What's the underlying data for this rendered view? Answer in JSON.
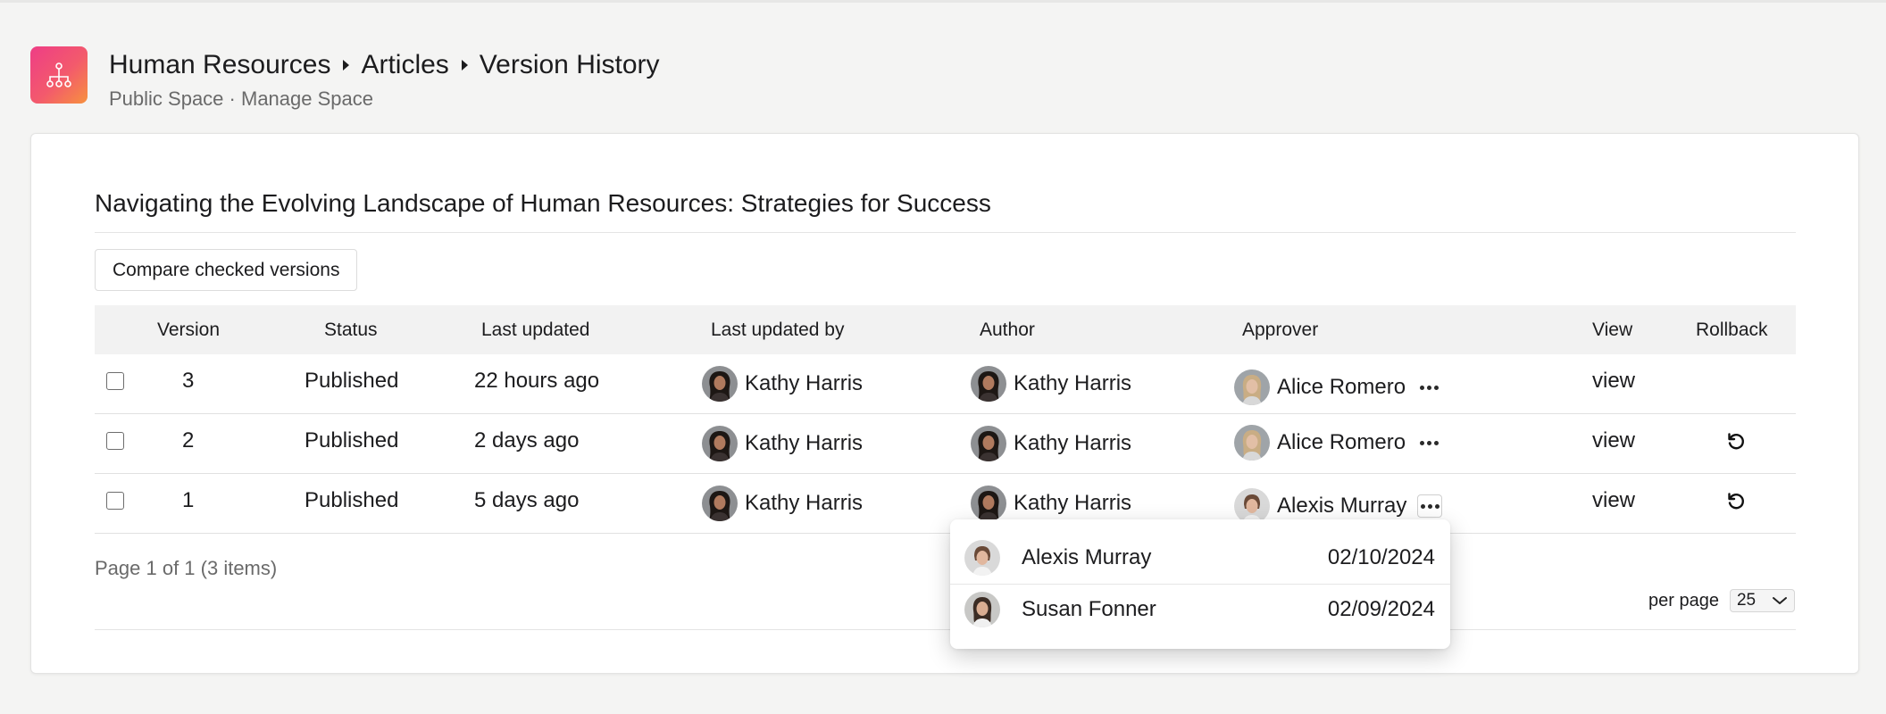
{
  "header": {
    "logo_icon": "org-chart-icon",
    "breadcrumbs": [
      "Human Resources",
      "Articles",
      "Version History"
    ],
    "subtitle_space": "Public Space",
    "subtitle_separator": "·",
    "subtitle_manage": "Manage Space"
  },
  "article": {
    "title": "Navigating the Evolving Landscape of Human Resources: Strategies for Success",
    "compare_button": "Compare checked versions"
  },
  "table": {
    "columns": {
      "version": "Version",
      "status": "Status",
      "last_updated": "Last updated",
      "last_updated_by": "Last updated by",
      "author": "Author",
      "approver": "Approver",
      "view": "View",
      "rollback": "Rollback"
    },
    "rows": [
      {
        "version": "3",
        "status": "Published",
        "last_updated": "22 hours ago",
        "last_updated_by": "Kathy Harris",
        "author": "Kathy Harris",
        "approver": "Alice Romero",
        "view": "view",
        "rollback": false
      },
      {
        "version": "2",
        "status": "Published",
        "last_updated": "2 days ago",
        "last_updated_by": "Kathy Harris",
        "author": "Kathy Harris",
        "approver": "Alice Romero",
        "view": "view",
        "rollback": true
      },
      {
        "version": "1",
        "status": "Published",
        "last_updated": "5 days ago",
        "last_updated_by": "Kathy Harris",
        "author": "Kathy Harris",
        "approver": "Alexis Murray",
        "view": "view",
        "rollback": true
      }
    ]
  },
  "pagination": {
    "summary": "Page 1 of 1 (3 items)",
    "per_page_label": "per page",
    "per_page_value": "25"
  },
  "approver_popover": {
    "entries": [
      {
        "name": "Alexis Murray",
        "date": "02/10/2024"
      },
      {
        "name": "Susan Fonner",
        "date": "02/09/2024"
      }
    ]
  },
  "colors": {
    "logo_gradient_start": "#ee3d86",
    "logo_gradient_end": "#f7913e",
    "page_background": "#f4f4f3",
    "table_header_background": "#f2f2f2"
  }
}
